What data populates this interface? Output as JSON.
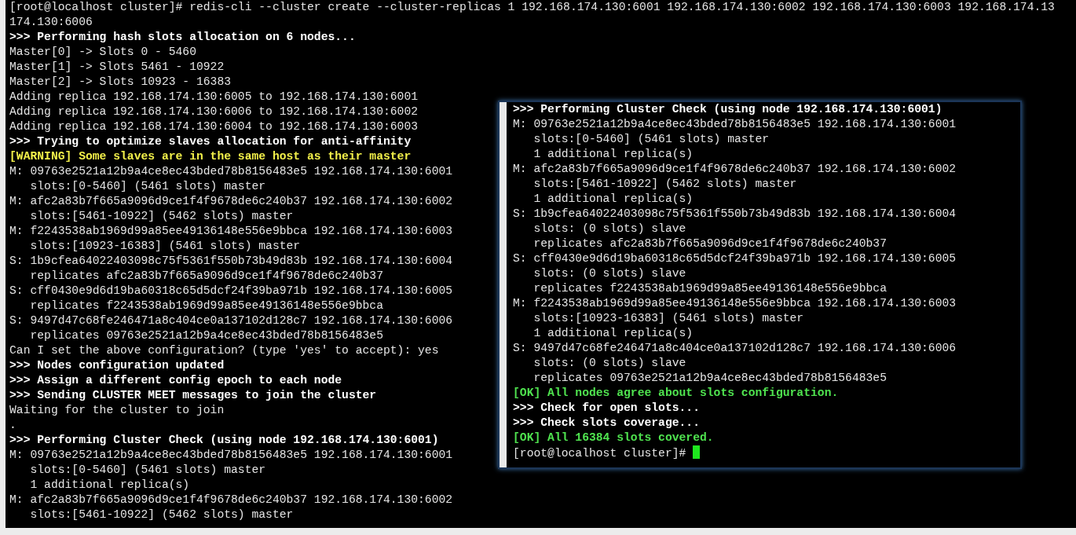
{
  "terminal": {
    "lines": [
      {
        "text": "[root@localhost cluster]# redis-cli --cluster create --cluster-replicas 1 192.168.174.130:6001 192.168.174.130:6002 192.168.174.130:6003 192.168.174.13",
        "kind": "normal"
      },
      {
        "text": "174.130:6006",
        "kind": "normal"
      },
      {
        "text": ">>> Performing hash slots allocation on 6 nodes...",
        "kind": "bold"
      },
      {
        "text": "Master[0] -> Slots 0 - 5460",
        "kind": "normal"
      },
      {
        "text": "Master[1] -> Slots 5461 - 10922",
        "kind": "normal"
      },
      {
        "text": "Master[2] -> Slots 10923 - 16383",
        "kind": "normal"
      },
      {
        "text": "Adding replica 192.168.174.130:6005 to 192.168.174.130:6001",
        "kind": "normal"
      },
      {
        "text": "Adding replica 192.168.174.130:6006 to 192.168.174.130:6002",
        "kind": "normal"
      },
      {
        "text": "Adding replica 192.168.174.130:6004 to 192.168.174.130:6003",
        "kind": "normal"
      },
      {
        "text": ">>> Trying to optimize slaves allocation for anti-affinity",
        "kind": "bold"
      },
      {
        "text": "[WARNING] Some slaves are in the same host as their master",
        "kind": "warning"
      },
      {
        "text": "M: 09763e2521a12b9a4ce8ec43bded78b8156483e5 192.168.174.130:6001",
        "kind": "normal"
      },
      {
        "text": "   slots:[0-5460] (5461 slots) master",
        "kind": "normal"
      },
      {
        "text": "M: afc2a83b7f665a9096d9ce1f4f9678de6c240b37 192.168.174.130:6002",
        "kind": "normal"
      },
      {
        "text": "   slots:[5461-10922] (5462 slots) master",
        "kind": "normal"
      },
      {
        "text": "M: f2243538ab1969d99a85ee49136148e556e9bbca 192.168.174.130:6003",
        "kind": "normal"
      },
      {
        "text": "   slots:[10923-16383] (5461 slots) master",
        "kind": "normal"
      },
      {
        "text": "S: 1b9cfea64022403098c75f5361f550b73b49d83b 192.168.174.130:6004",
        "kind": "normal"
      },
      {
        "text": "   replicates afc2a83b7f665a9096d9ce1f4f9678de6c240b37",
        "kind": "normal"
      },
      {
        "text": "S: cff0430e9d6d19ba60318c65d5dcf24f39ba971b 192.168.174.130:6005",
        "kind": "normal"
      },
      {
        "text": "   replicates f2243538ab1969d99a85ee49136148e556e9bbca",
        "kind": "normal"
      },
      {
        "text": "S: 9497d47c68fe246471a8c404ce0a137102d128c7 192.168.174.130:6006",
        "kind": "normal"
      },
      {
        "text": "   replicates 09763e2521a12b9a4ce8ec43bded78b8156483e5",
        "kind": "normal"
      },
      {
        "text": "Can I set the above configuration? (type 'yes' to accept): yes",
        "kind": "normal"
      },
      {
        "text": ">>> Nodes configuration updated",
        "kind": "bold"
      },
      {
        "text": ">>> Assign a different config epoch to each node",
        "kind": "bold"
      },
      {
        "text": ">>> Sending CLUSTER MEET messages to join the cluster",
        "kind": "bold"
      },
      {
        "text": "Waiting for the cluster to join",
        "kind": "normal"
      },
      {
        "text": ".",
        "kind": "normal"
      },
      {
        "text": ">>> Performing Cluster Check (using node 192.168.174.130:6001)",
        "kind": "bold"
      },
      {
        "text": "M: 09763e2521a12b9a4ce8ec43bded78b8156483e5 192.168.174.130:6001",
        "kind": "normal"
      },
      {
        "text": "   slots:[0-5460] (5461 slots) master",
        "kind": "normal"
      },
      {
        "text": "   1 additional replica(s)",
        "kind": "normal"
      },
      {
        "text": "M: afc2a83b7f665a9096d9ce1f4f9678de6c240b37 192.168.174.130:6002",
        "kind": "normal"
      },
      {
        "text": "   slots:[5461-10922] (5462 slots) master",
        "kind": "normal"
      }
    ]
  },
  "overlay_terminal": {
    "cursor_visible": true,
    "lines": [
      {
        "text": ">>> Performing Cluster Check (using node 192.168.174.130:6001)",
        "kind": "bold"
      },
      {
        "text": "M: 09763e2521a12b9a4ce8ec43bded78b8156483e5 192.168.174.130:6001",
        "kind": "normal"
      },
      {
        "text": "   slots:[0-5460] (5461 slots) master",
        "kind": "normal"
      },
      {
        "text": "   1 additional replica(s)",
        "kind": "normal"
      },
      {
        "text": "M: afc2a83b7f665a9096d9ce1f4f9678de6c240b37 192.168.174.130:6002",
        "kind": "normal"
      },
      {
        "text": "   slots:[5461-10922] (5462 slots) master",
        "kind": "normal"
      },
      {
        "text": "   1 additional replica(s)",
        "kind": "normal"
      },
      {
        "text": "S: 1b9cfea64022403098c75f5361f550b73b49d83b 192.168.174.130:6004",
        "kind": "normal"
      },
      {
        "text": "   slots: (0 slots) slave",
        "kind": "normal"
      },
      {
        "text": "   replicates afc2a83b7f665a9096d9ce1f4f9678de6c240b37",
        "kind": "normal"
      },
      {
        "text": "S: cff0430e9d6d19ba60318c65d5dcf24f39ba971b 192.168.174.130:6005",
        "kind": "normal"
      },
      {
        "text": "   slots: (0 slots) slave",
        "kind": "normal"
      },
      {
        "text": "   replicates f2243538ab1969d99a85ee49136148e556e9bbca",
        "kind": "normal"
      },
      {
        "text": "M: f2243538ab1969d99a85ee49136148e556e9bbca 192.168.174.130:6003",
        "kind": "normal"
      },
      {
        "text": "   slots:[10923-16383] (5461 slots) master",
        "kind": "normal"
      },
      {
        "text": "   1 additional replica(s)",
        "kind": "normal"
      },
      {
        "text": "S: 9497d47c68fe246471a8c404ce0a137102d128c7 192.168.174.130:6006",
        "kind": "normal"
      },
      {
        "text": "   slots: (0 slots) slave",
        "kind": "normal"
      },
      {
        "text": "   replicates 09763e2521a12b9a4ce8ec43bded78b8156483e5",
        "kind": "normal"
      },
      {
        "text": "[OK] All nodes agree about slots configuration.",
        "kind": "ok"
      },
      {
        "text": ">>> Check for open slots...",
        "kind": "bold"
      },
      {
        "text": ">>> Check slots coverage...",
        "kind": "bold"
      },
      {
        "text": "[OK] All 16384 slots covered.",
        "kind": "ok"
      },
      {
        "text": "[root@localhost cluster]# ",
        "kind": "prompt"
      }
    ]
  }
}
